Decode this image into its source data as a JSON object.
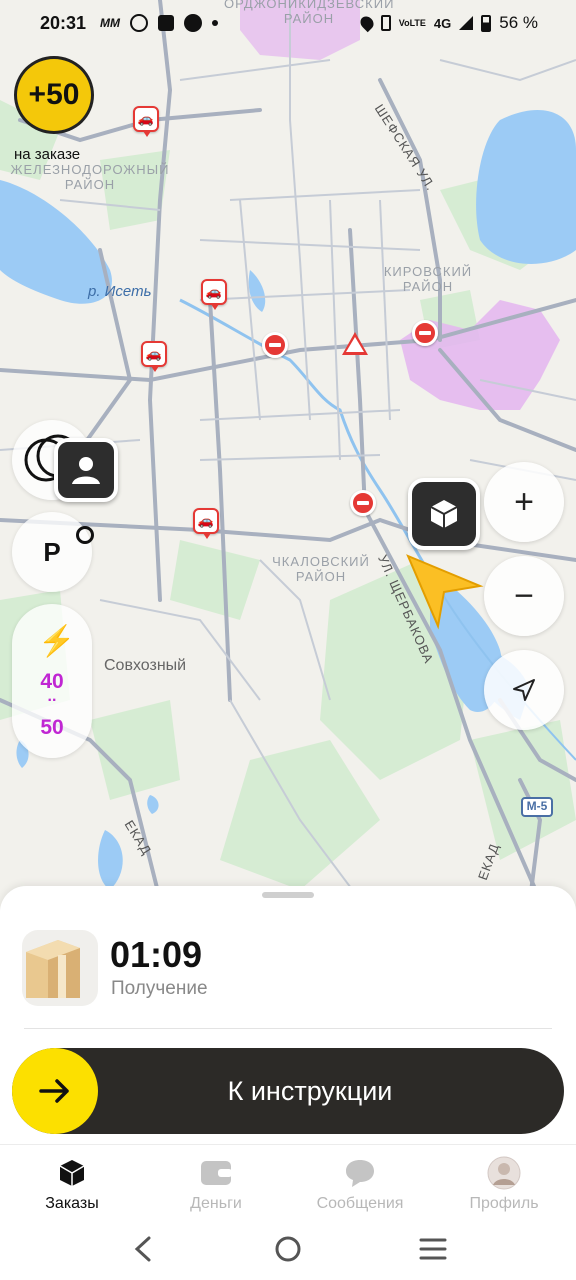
{
  "status_bar": {
    "time": "20:31",
    "left_icons": [
      "mm-icon",
      "pinterest-icon",
      "bag-icon",
      "leaf-icon",
      "dot-icon"
    ],
    "network": "4G",
    "volte": "VoLTE",
    "battery": "56 %"
  },
  "map": {
    "districts": {
      "ordzhonikidzevsky": "ОРДЖОНИКИДЗЕВСКИЙ\nРАЙОН",
      "zheleznodorozhny": "ЖЕЛЕЗНОДОРОЖНЫЙ\nРАЙОН",
      "kirovsky": "КИРОВСКИЙ\nРАЙОН",
      "chkalovsky": "ЧКАЛОВСКИЙ\nРАЙОН"
    },
    "streets": {
      "shefskaya": "ШЕФСКАЯ УЛ.",
      "shcherbakova": "УЛ. ЩЕРБАКОВА",
      "ekad": "ЕКАД",
      "ekad2": "ЕКАД"
    },
    "river": "р. Исеть",
    "place": "Совхозный",
    "highway": "М-5",
    "colors": {
      "traffic_zone": "#e4b5f0",
      "water": "#9ccbf5",
      "green": "#cfe9cf",
      "road": "#b7bfcc"
    }
  },
  "bonus": {
    "value": "+50",
    "label": "на заказе"
  },
  "left_controls": {
    "parking_label": "P",
    "surge_values": [
      "40",
      "50"
    ]
  },
  "order": {
    "timer": "01:09",
    "stage": "Получение",
    "cta_label": "К инструкции"
  },
  "tabs": [
    {
      "label": "Заказы",
      "icon": "box-icon",
      "active": true
    },
    {
      "label": "Деньги",
      "icon": "wallet-icon",
      "active": false
    },
    {
      "label": "Сообщения",
      "icon": "chat-icon",
      "active": false
    },
    {
      "label": "Профиль",
      "icon": "profile-avatar-icon",
      "active": false
    }
  ],
  "accent": "#fce000"
}
